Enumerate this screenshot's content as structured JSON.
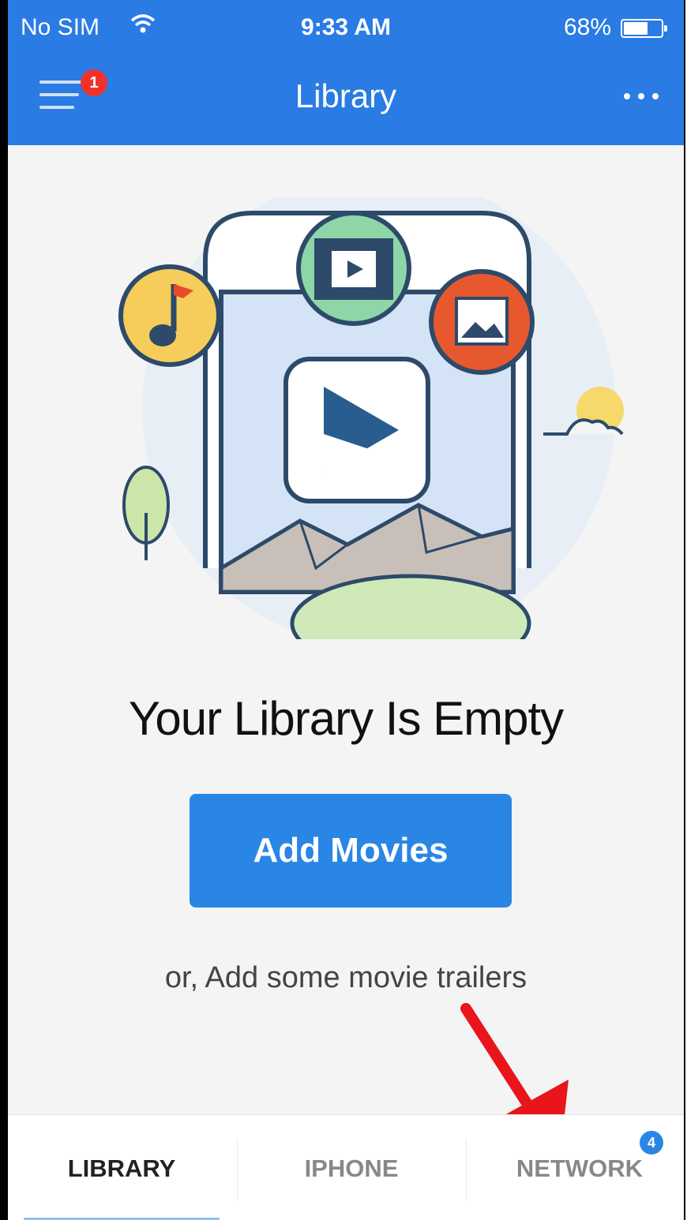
{
  "status_bar": {
    "carrier": "No SIM",
    "time": "9:33 AM",
    "battery": "68%",
    "battery_level": 0.68
  },
  "header": {
    "title": "Library",
    "menu_badge": "1",
    "menu_icon": "hamburger-icon",
    "more_icon": "more-horizontal-icon",
    "color": "#2a7be4"
  },
  "main": {
    "empty_title": "Your Library Is Empty",
    "add_button_label": "Add Movies",
    "secondary_link": "or, Add some movie trailers"
  },
  "tabs": [
    {
      "label": "LIBRARY",
      "active": true
    },
    {
      "label": "IPHONE",
      "active": false
    },
    {
      "label": "NETWORK",
      "active": false,
      "badge": "4"
    }
  ],
  "colors": {
    "accent": "#2a86e4",
    "badge_red": "#f0322d",
    "annotation_arrow": "#e8161b"
  }
}
